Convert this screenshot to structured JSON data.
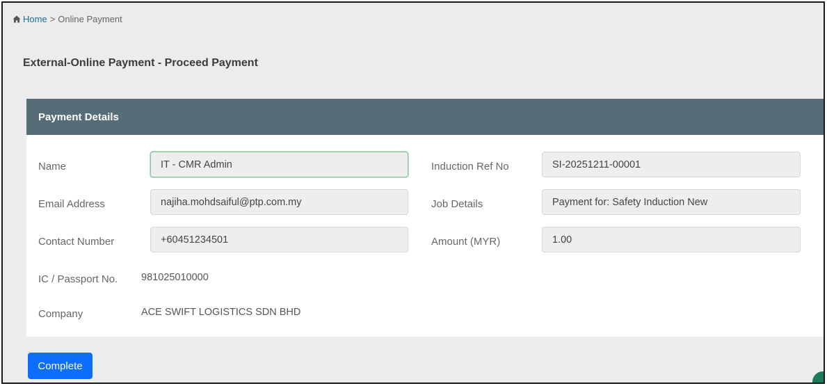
{
  "breadcrumb": {
    "home": "Home",
    "separator": ">",
    "current": "Online Payment"
  },
  "page": {
    "title": "External-Online Payment - Proceed Payment"
  },
  "panel": {
    "title": "Payment Details"
  },
  "fields": {
    "name": {
      "label": "Name",
      "value": "IT - CMR Admin"
    },
    "email": {
      "label": "Email Address",
      "value": "najiha.mohdsaiful@ptp.com.my"
    },
    "contact": {
      "label": "Contact Number",
      "value": "+60451234501"
    },
    "ic": {
      "label": "IC / Passport No.",
      "value": "981025010000"
    },
    "company": {
      "label": "Company",
      "value": "ACE SWIFT LOGISTICS SDN BHD"
    },
    "induction_ref": {
      "label": "Induction Ref No",
      "value": "SI-20251211-00001"
    },
    "job_details": {
      "label": "Job Details",
      "value": "Payment for: Safety Induction New"
    },
    "amount": {
      "label": "Amount (MYR)",
      "value": "1.00"
    }
  },
  "actions": {
    "complete_label": "Complete"
  },
  "icons": {
    "home": "home-icon"
  },
  "colors": {
    "header": "#566d78",
    "primary_button": "#0d6efd",
    "link": "#1a6f9a"
  }
}
